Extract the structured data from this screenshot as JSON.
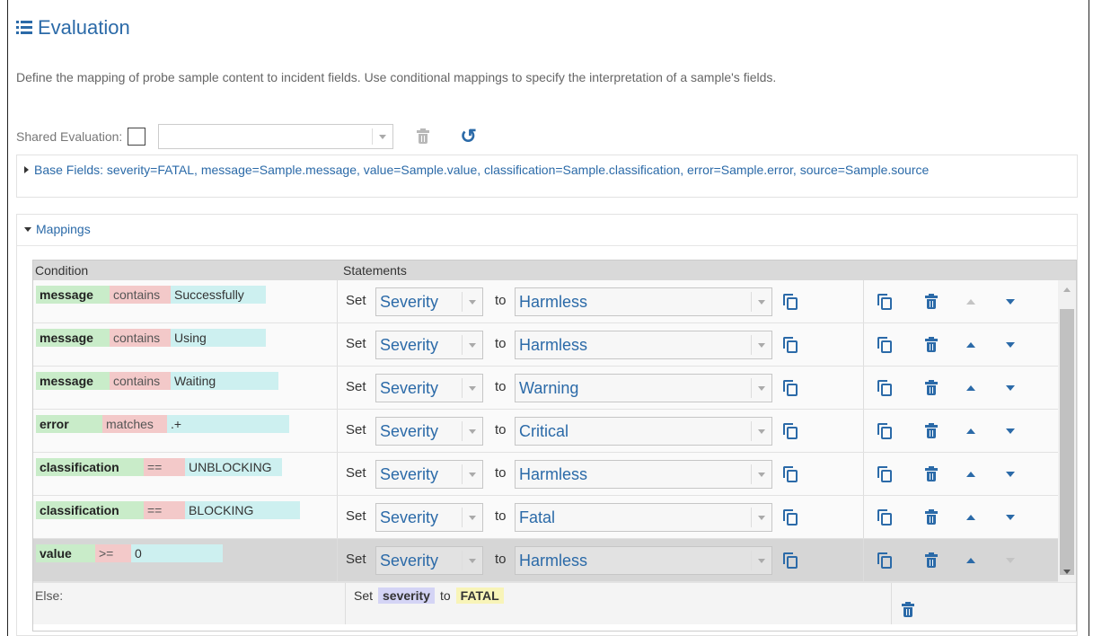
{
  "page": {
    "title": "Evaluation",
    "description": "Define the mapping of probe sample content to incident fields. Use conditional mappings to specify the interpretation of a sample's fields."
  },
  "shared": {
    "label": "Shared Evaluation:",
    "value": ""
  },
  "base_fields": {
    "text": "Base Fields: severity=FATAL, message=Sample.message, value=Sample.value, classification=Sample.classification, error=Sample.error, source=Sample.source"
  },
  "mappings": {
    "label": "Mappings",
    "columns": {
      "condition": "Condition",
      "statements": "Statements"
    },
    "set_label": "Set",
    "to_label": "to",
    "rows": [
      {
        "field": "message",
        "op": "contains",
        "value": "Successfully",
        "target": "Severity",
        "result": "Harmless"
      },
      {
        "field": "message",
        "op": "contains",
        "value": "Using",
        "target": "Severity",
        "result": "Harmless"
      },
      {
        "field": "message",
        "op": "contains",
        "value": "Waiting",
        "target": "Severity",
        "result": "Warning"
      },
      {
        "field": "error",
        "op": "matches",
        "value": ".+",
        "target": "Severity",
        "result": "Critical"
      },
      {
        "field": "classification",
        "op": "==",
        "value": "UNBLOCKING",
        "target": "Severity",
        "result": "Harmless"
      },
      {
        "field": "classification",
        "op": "==",
        "value": "BLOCKING",
        "target": "Severity",
        "result": "Fatal"
      },
      {
        "field": "value",
        "op": ">=",
        "value": "0",
        "target": "Severity",
        "result": "Harmless"
      }
    ],
    "else": {
      "label": "Else:",
      "set": "Set",
      "field": "severity",
      "to": "to",
      "value": "FATAL"
    }
  },
  "colors": {
    "accent": "#2b6aa8",
    "field_chip": "#c9ecc9",
    "op_chip": "#f3c9c9",
    "value_chip": "#cdf0f0"
  }
}
